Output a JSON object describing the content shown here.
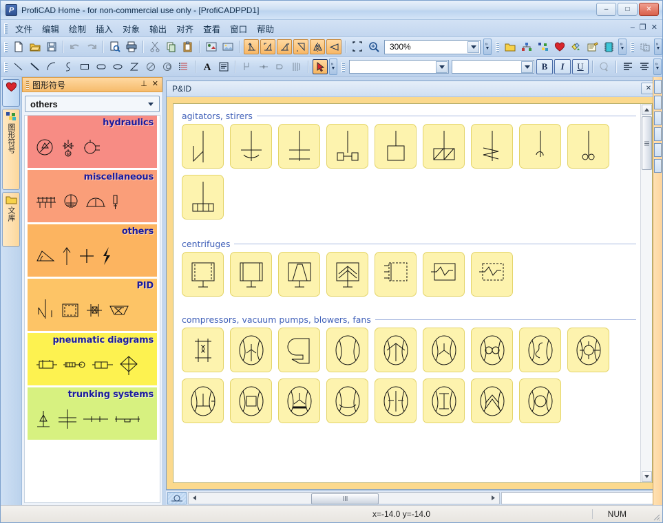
{
  "window": {
    "title": "ProfiCAD Home - for non-commercial use only - [ProfiCADPPD1]",
    "app_icon": "proficad-logo-icon",
    "minimize": "–",
    "maximize": "□",
    "close": "✕"
  },
  "menu": {
    "items": [
      {
        "label": "文件"
      },
      {
        "label": "编辑"
      },
      {
        "label": "绘制"
      },
      {
        "label": "插入"
      },
      {
        "label": "对象"
      },
      {
        "label": "输出"
      },
      {
        "label": "对齐"
      },
      {
        "label": "查看"
      },
      {
        "label": "窗口"
      },
      {
        "label": "帮助"
      }
    ],
    "mdi_minimize": "–",
    "mdi_restore": "❐",
    "mdi_close": "✕"
  },
  "toolbar_main": {
    "zoom_value": "300%",
    "buttons": [
      {
        "name": "new-file-icon"
      },
      {
        "name": "open-file-icon"
      },
      {
        "name": "save-file-icon"
      },
      {
        "name": "undo-icon"
      },
      {
        "name": "redo-icon"
      },
      {
        "name": "print-preview-icon"
      },
      {
        "name": "print-icon"
      },
      {
        "name": "cut-icon"
      },
      {
        "name": "copy-icon"
      },
      {
        "name": "paste-icon"
      },
      {
        "name": "insert-symbol-icon"
      },
      {
        "name": "insert-image-icon"
      },
      {
        "name": "rotate-left-icon"
      },
      {
        "name": "rotate-up-icon"
      },
      {
        "name": "rotate-right-icon"
      },
      {
        "name": "rotate-down-icon"
      },
      {
        "name": "mirror-horizontal-icon"
      },
      {
        "name": "mirror-vertical-icon"
      },
      {
        "name": "fit-page-icon"
      },
      {
        "name": "zoom-in-icon"
      }
    ],
    "buttons_right": [
      {
        "name": "folder-icon"
      },
      {
        "name": "hierarchy-icon"
      },
      {
        "name": "netlist-icon"
      },
      {
        "name": "favorites-heart-icon"
      },
      {
        "name": "colors-icon"
      },
      {
        "name": "notes-icon"
      },
      {
        "name": "ic-chip-icon"
      },
      {
        "name": "group-objects-icon"
      },
      {
        "name": "align-left-icon"
      },
      {
        "name": "align-center-icon"
      },
      {
        "name": "align-right-icon"
      }
    ]
  },
  "toolbar_draw": {
    "buttons": [
      {
        "name": "line-icon"
      },
      {
        "name": "line2-icon"
      },
      {
        "name": "arc-icon"
      },
      {
        "name": "bezier-icon"
      },
      {
        "name": "rectangle-icon"
      },
      {
        "name": "rounded-rect-icon"
      },
      {
        "name": "ellipse-icon"
      },
      {
        "name": "hourglass-icon"
      },
      {
        "name": "no-fill-circle-icon"
      },
      {
        "name": "filled-circle-icon"
      },
      {
        "name": "list-icon"
      },
      {
        "name": "text-icon"
      },
      {
        "name": "textbox-icon"
      },
      {
        "name": "wire-icon"
      },
      {
        "name": "junction-icon"
      },
      {
        "name": "terminal-icon"
      },
      {
        "name": "bus-icon"
      },
      {
        "name": "select-arrow-icon"
      }
    ],
    "font_value": "",
    "size_value": "",
    "bold_label": "B",
    "italic_label": "I",
    "underline_label": "U",
    "format_painter": "format-painter-icon",
    "align_left": "align-left-icon",
    "align_center": "align-center-icon"
  },
  "sidebar_tabs": [
    {
      "label": "",
      "icon": "favorites-heart-icon",
      "active": true
    },
    {
      "label": "图形符号",
      "icon": "symbols-icon",
      "active": false
    },
    {
      "label": "文库",
      "icon": "folder-icon",
      "active": false
    }
  ],
  "symbols_panel": {
    "title": "图形符号",
    "pin_icon": "pin-icon",
    "close_icon": "close-icon",
    "category_value": "others",
    "groups": [
      {
        "title": "hydraulics",
        "color": "#f78c84",
        "symbols": [
          "hydraulic-valve-icon",
          "hydraulic-motor-icon",
          "hydraulic-pump-icon"
        ]
      },
      {
        "title": "miscellaneous",
        "color": "#fa9e79",
        "symbols": [
          "antenna-array-icon",
          "earth-ground-icon",
          "dome-icon",
          "probe-icon"
        ]
      },
      {
        "title": "others",
        "color": "#fcb460",
        "symbols": [
          "angle-icon",
          "arrow-up-icon",
          "cross-icon",
          "lightning-icon"
        ]
      },
      {
        "title": "PID",
        "color": "#fdc466",
        "symbols": [
          "agitator-icon",
          "vessel-icon",
          "valve-icon",
          "hopper-icon"
        ]
      },
      {
        "title": "pneumatic diagrams",
        "color": "#fdf250",
        "symbols": [
          "cylinder-icon",
          "actuator-icon",
          "cylinder2-icon",
          "diamond-valve-icon"
        ]
      },
      {
        "title": "trunking systems",
        "color": "#d7f180",
        "symbols": [
          "trunk-riser-icon",
          "trunk-cross-icon",
          "trunk-line-icon",
          "trunk-bend-icon"
        ]
      }
    ]
  },
  "document": {
    "title": "P&ID",
    "close_label": "✕",
    "sections": [
      {
        "title": "agitators, stirers",
        "tiles": [
          {
            "name": "agitator-paddle-z"
          },
          {
            "name": "agitator-anchor"
          },
          {
            "name": "agitator-flat-blade"
          },
          {
            "name": "agitator-twin-block"
          },
          {
            "name": "agitator-box"
          },
          {
            "name": "agitator-split-box"
          },
          {
            "name": "agitator-zigzag"
          },
          {
            "name": "agitator-small-hook"
          },
          {
            "name": "agitator-coil"
          },
          {
            "name": "agitator-comb"
          }
        ]
      },
      {
        "title": "centrifuges",
        "tiles": [
          {
            "name": "centrifuge-dashed-box"
          },
          {
            "name": "centrifuge-solid-box"
          },
          {
            "name": "centrifuge-cone"
          },
          {
            "name": "centrifuge-disc-stack"
          },
          {
            "name": "centrifuge-side-feed"
          },
          {
            "name": "centrifuge-zigzag"
          },
          {
            "name": "centrifuge-zigzag-dashed"
          }
        ]
      },
      {
        "title": "compressors, vacuum pumps, blowers, fans",
        "tiles": [
          {
            "name": "compressor-piston"
          },
          {
            "name": "fan-three-blade-stand"
          },
          {
            "name": "blower-scroll"
          },
          {
            "name": "compressor-plain"
          },
          {
            "name": "compressor-vane"
          },
          {
            "name": "fan-three-blade"
          },
          {
            "name": "compressor-twin-lobe"
          },
          {
            "name": "compressor-screw"
          },
          {
            "name": "compressor-rotary-star"
          },
          {
            "name": "compressor-tee"
          },
          {
            "name": "compressor-square"
          },
          {
            "name": "fan-propeller-bar"
          },
          {
            "name": "compressor-curve"
          },
          {
            "name": "compressor-cross-stem"
          },
          {
            "name": "compressor-ibeam"
          },
          {
            "name": "compressor-chevron"
          },
          {
            "name": "compressor-circle"
          }
        ]
      }
    ]
  },
  "statusbar": {
    "coords": "x=-14.0  y=-14.0",
    "num_indicator": "NUM"
  }
}
